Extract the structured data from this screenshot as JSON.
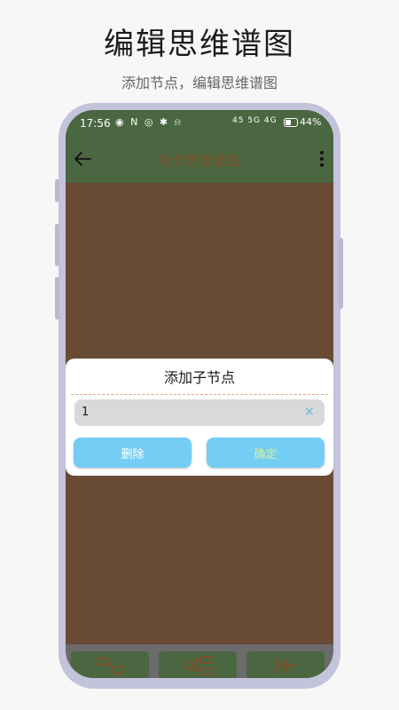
{
  "promo": {
    "title": "编辑思维谱图",
    "subtitle": "添加节点，编辑思维谱图"
  },
  "status_bar": {
    "time": "17:56",
    "icons": "◉ N ◎ ✱ ⍾",
    "network": "45 5G 4G",
    "battery": "44%"
  },
  "app_bar": {
    "title": "制作思维谱图",
    "back_icon": "arrow-left-icon",
    "more_icon": "more-vertical-icon"
  },
  "dialog": {
    "title": "添加子节点",
    "input_value": "1",
    "clear_icon": "×",
    "delete_label": "删除",
    "confirm_label": "确定"
  },
  "toolbar": {
    "items": [
      {
        "icon": "connect-nodes-icon"
      },
      {
        "icon": "tree-structure-icon"
      },
      {
        "icon": "collapse-left-icon"
      }
    ]
  },
  "colors": {
    "app_bar": "#4a6741",
    "canvas": "#694a33",
    "button": "#74cdf5",
    "confirm_text": "#d8ef9b",
    "phone_frame": "#c3c3dc"
  }
}
